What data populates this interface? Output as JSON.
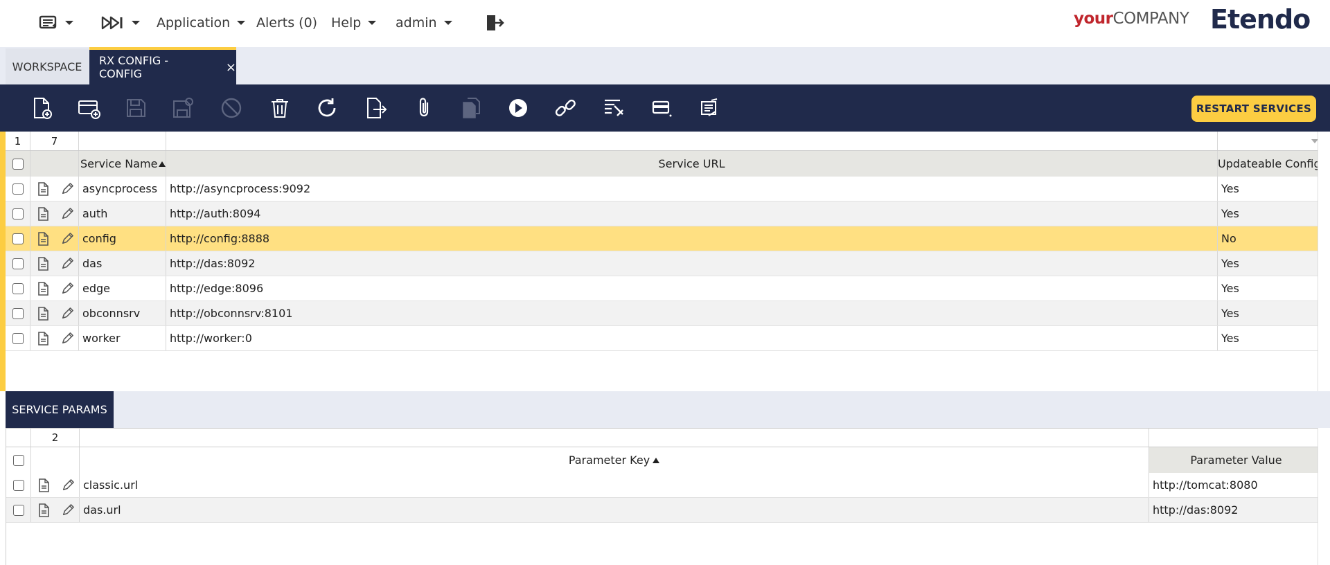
{
  "topnav": {
    "application": "Application",
    "alerts": "Alerts (0)",
    "help": "Help",
    "user": "admin"
  },
  "brand": {
    "your": "your",
    "company": "COMPANY",
    "etendo": "Etendo"
  },
  "tabs": {
    "workspace": "WORKSPACE",
    "active": "RX CONFIG - CONFIG",
    "close": "×"
  },
  "toolbar": {
    "restart_label": "RESTART SERVICES"
  },
  "main_grid": {
    "selected_count": "1",
    "total_count": "7",
    "columns": {
      "name": "Service Name",
      "url": "Service URL",
      "updateable": "Updateable Configs"
    },
    "rows": [
      {
        "name": "asyncprocess",
        "url": "http://asyncprocess:9092",
        "updateable": "Yes"
      },
      {
        "name": "auth",
        "url": "http://auth:8094",
        "updateable": "Yes"
      },
      {
        "name": "config",
        "url": "http://config:8888",
        "updateable": "No"
      },
      {
        "name": "das",
        "url": "http://das:8092",
        "updateable": "Yes"
      },
      {
        "name": "edge",
        "url": "http://edge:8096",
        "updateable": "Yes"
      },
      {
        "name": "obconnsrv",
        "url": "http://obconnsrv:8101",
        "updateable": "Yes"
      },
      {
        "name": "worker",
        "url": "http://worker:0",
        "updateable": "Yes"
      }
    ]
  },
  "subtab": {
    "label": "SERVICE PARAMS"
  },
  "param_grid": {
    "total_count": "2",
    "columns": {
      "key": "Parameter Key",
      "value": "Parameter Value"
    },
    "rows": [
      {
        "key": "classic.url",
        "value": "http://tomcat:8080"
      },
      {
        "key": "das.url",
        "value": "http://das:8092"
      }
    ]
  },
  "colors": {
    "navy": "#202a4b",
    "accent": "#fccd42",
    "selected_row": "#ffe082"
  }
}
